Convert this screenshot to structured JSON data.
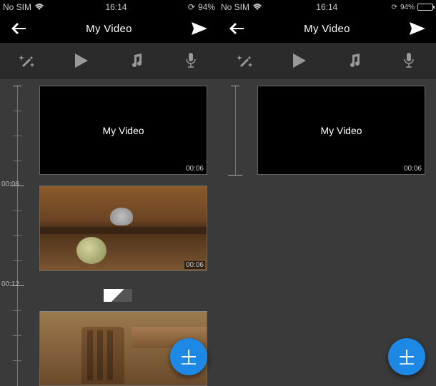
{
  "left": {
    "status": {
      "carrier": "No SIM",
      "time": "16:14",
      "battery": "94%",
      "loading_icon": "⟳"
    },
    "nav": {
      "title": "My Video"
    },
    "timeline": {
      "marks": {
        "t0": "",
        "t1": "00:06",
        "t2": "00:12"
      },
      "title_clip": {
        "text": "My Video",
        "duration": "00:06"
      },
      "clip1": {
        "duration": "00:06"
      }
    }
  },
  "right": {
    "status": {
      "carrier": "No SIM",
      "time": "16:14",
      "battery": "94%",
      "loading_icon": "⟳"
    },
    "nav": {
      "title": "My Video"
    },
    "timeline": {
      "title_clip": {
        "text": "My Video",
        "duration": "00:06"
      }
    }
  }
}
